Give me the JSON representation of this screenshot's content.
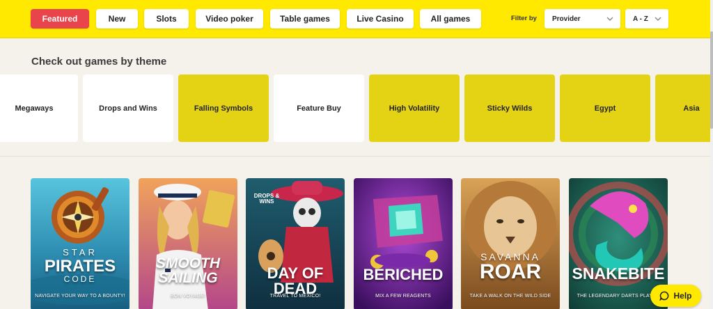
{
  "tabs": [
    {
      "label": "Featured",
      "active": true
    },
    {
      "label": "New",
      "active": false
    },
    {
      "label": "Slots",
      "active": false
    },
    {
      "label": "Video poker",
      "active": false
    },
    {
      "label": "Table games",
      "active": false
    },
    {
      "label": "Live Casino",
      "active": false
    },
    {
      "label": "All games",
      "active": false
    }
  ],
  "filter": {
    "label": "Filter by",
    "provider": "Provider",
    "sort": "A - Z"
  },
  "themes": {
    "title": "Check out games by theme",
    "items": [
      {
        "label": "Megaways",
        "highlight": false
      },
      {
        "label": "Drops and Wins",
        "highlight": false
      },
      {
        "label": "Falling Symbols",
        "highlight": true
      },
      {
        "label": "Feature Buy",
        "highlight": false
      },
      {
        "label": "High Volatility",
        "highlight": true
      },
      {
        "label": "Sticky Wilds",
        "highlight": true
      },
      {
        "label": "Egypt",
        "highlight": true
      },
      {
        "label": "Asia",
        "highlight": true
      }
    ]
  },
  "games": [
    {
      "title_top": "STAR",
      "title_main": "PIRATES",
      "title_sub": "CODE",
      "tagline": "NAVIGATE YOUR WAY TO A BOUNTY!"
    },
    {
      "title_main": "SMOOTH",
      "title_sub": "SAILING",
      "tagline": "BON VOYAGE!"
    },
    {
      "badge": "DROPS & WINS",
      "title_main": "DAY OF DEAD",
      "tagline": "TRAVEL TO MEXICO!"
    },
    {
      "title_main": "BERICHED",
      "tagline": "MIX A FEW REAGENTS"
    },
    {
      "title_top": "SAVANNA",
      "title_main": "ROAR",
      "tagline": "TAKE A WALK ON THE WILD SIDE"
    },
    {
      "title_main": "SNAKEBITE",
      "tagline": "THE LEGENDARY DARTS PLAYER"
    }
  ],
  "help": {
    "label": "Help"
  },
  "colors": {
    "topbar": "#ffe900",
    "active_tab": "#e9434c",
    "theme_highlight": "#e4d314",
    "page_bg": "#f5f2ec"
  }
}
